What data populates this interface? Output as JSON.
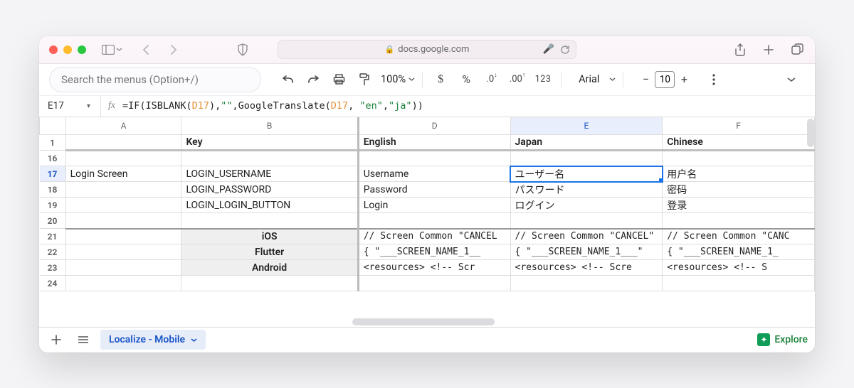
{
  "browser": {
    "url_display": "docs.google.com"
  },
  "toolbar": {
    "search_placeholder": "Search the menus (Option+/)",
    "zoom": "100%",
    "font_name": "Arial",
    "font_size": "10"
  },
  "formula_bar": {
    "cell_ref": "E17",
    "formula_plain": "=IF(ISBLANK(D17),\"\",GoogleTranslate(D17, \"en\",\"ja\"))",
    "formula_parts": [
      {
        "t": "=",
        "c": "fn"
      },
      {
        "t": "IF",
        "c": "fn"
      },
      {
        "t": "(",
        "c": "paren"
      },
      {
        "t": "ISBLANK",
        "c": "fn"
      },
      {
        "t": "(",
        "c": "paren"
      },
      {
        "t": "D17",
        "c": "ref"
      },
      {
        "t": ")",
        "c": "paren"
      },
      {
        "t": ",",
        "c": "fn"
      },
      {
        "t": "\"\"",
        "c": "str"
      },
      {
        "t": ",",
        "c": "fn"
      },
      {
        "t": "GoogleTranslate",
        "c": "fn"
      },
      {
        "t": "(",
        "c": "paren"
      },
      {
        "t": "D17",
        "c": "ref"
      },
      {
        "t": ", ",
        "c": "fn"
      },
      {
        "t": "\"en\"",
        "c": "str"
      },
      {
        "t": ",",
        "c": "fn"
      },
      {
        "t": "\"ja\"",
        "c": "str"
      },
      {
        "t": ")",
        "c": "paren"
      },
      {
        "t": ")",
        "c": "paren"
      }
    ]
  },
  "columns": [
    "A",
    "B",
    "D",
    "E",
    "F"
  ],
  "selected_column": "E",
  "selected_row": "17",
  "header_row": {
    "num": "1",
    "A": "",
    "B": "Key",
    "D": "English",
    "E": "Japan",
    "F": "Chinese"
  },
  "rows": [
    {
      "num": "16",
      "A": "",
      "B": "",
      "D": "",
      "E": "",
      "F": ""
    },
    {
      "num": "17",
      "A": "Login Screen",
      "B": "LOGIN_USERNAME",
      "D": "Username",
      "E": "ユーザー名",
      "F": "用户名",
      "selected": true
    },
    {
      "num": "18",
      "A": "",
      "B": "LOGIN_PASSWORD",
      "D": "Password",
      "E": "パスワード",
      "F": "密码"
    },
    {
      "num": "19",
      "A": "",
      "B": "LOGIN_LOGIN_BUTTON",
      "D": "Login",
      "E": "ログイン",
      "F": "登录"
    },
    {
      "num": "20",
      "A": "",
      "B": "",
      "D": "",
      "E": "",
      "F": ""
    },
    {
      "num": "21",
      "A": "",
      "B": "iOS",
      "D": "  // Screen Common \"CANCEL",
      "E": "  // Screen Common \"CANCEL\"",
      "F": "  // Screen Common \"CANC",
      "shade": true,
      "thick": true
    },
    {
      "num": "22",
      "A": "",
      "B": "Flutter",
      "D": "{     \"___SCREEN_NAME_1__",
      "E": "{     \"___SCREEN_NAME_1___\"",
      "F": "{     \"___SCREEN_NAME_1_",
      "shade": true
    },
    {
      "num": "23",
      "A": "",
      "B": "Android",
      "D": "<resources>       <!-- Scr",
      "E": "<resources>       <!-- Scre",
      "F": "<resources>       <!-- S",
      "shade": true
    },
    {
      "num": "24",
      "A": "",
      "B": "",
      "D": "",
      "E": "",
      "F": ""
    }
  ],
  "sheet_tab": "Localize - Mobile",
  "explore_label": "Explore"
}
